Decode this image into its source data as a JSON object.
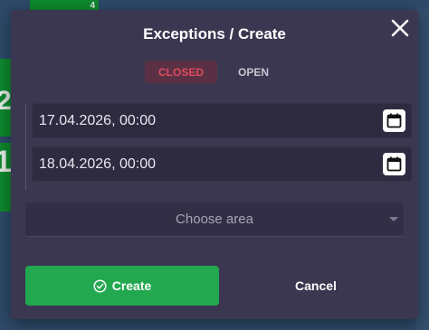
{
  "background": {
    "top_tile_label": "4",
    "left_tile_1_label": "2",
    "left_tile_2_label": "1"
  },
  "modal": {
    "title": "Exceptions / Create",
    "tabs": [
      {
        "label": "CLOSED",
        "active": true
      },
      {
        "label": "OPEN",
        "active": false
      }
    ],
    "start_date": "17.04.2026, 00:00",
    "end_date": "18.04.2026, 00:00",
    "area_select": {
      "placeholder": "Choose area"
    },
    "create_label": "Create",
    "cancel_label": "Cancel"
  },
  "colors": {
    "modal_bg": "#3b3751",
    "accent_green": "#22a84f",
    "closed_red": "#e04a5e"
  },
  "icons": [
    "close-icon",
    "calendar-icon",
    "check-circle-icon",
    "chevron-down-icon"
  ]
}
